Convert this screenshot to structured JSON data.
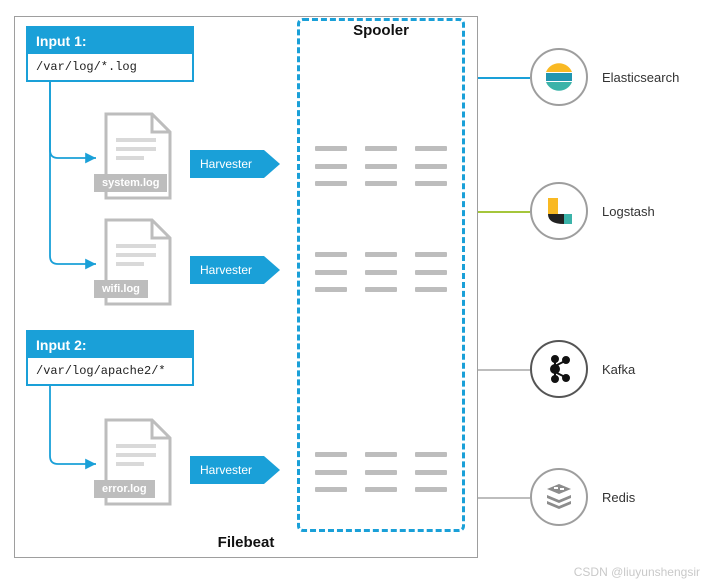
{
  "filebeat_label": "Filebeat",
  "spooler_label": "Spooler",
  "inputs": [
    {
      "title": "Input 1:",
      "path": "/var/log/*.log"
    },
    {
      "title": "Input 2:",
      "path": "/var/log/apache2/*"
    }
  ],
  "logfiles": [
    {
      "name": "system.log"
    },
    {
      "name": "wifi.log"
    },
    {
      "name": "error.log"
    }
  ],
  "harvester_label": "Harvester",
  "outputs": [
    {
      "name": "Elasticsearch",
      "icon": "elasticsearch-icon"
    },
    {
      "name": "Logstash",
      "icon": "logstash-icon"
    },
    {
      "name": "Kafka",
      "icon": "kafka-icon"
    },
    {
      "name": "Redis",
      "icon": "redis-icon"
    }
  ],
  "watermark": "CSDN @liuyunshengsir"
}
